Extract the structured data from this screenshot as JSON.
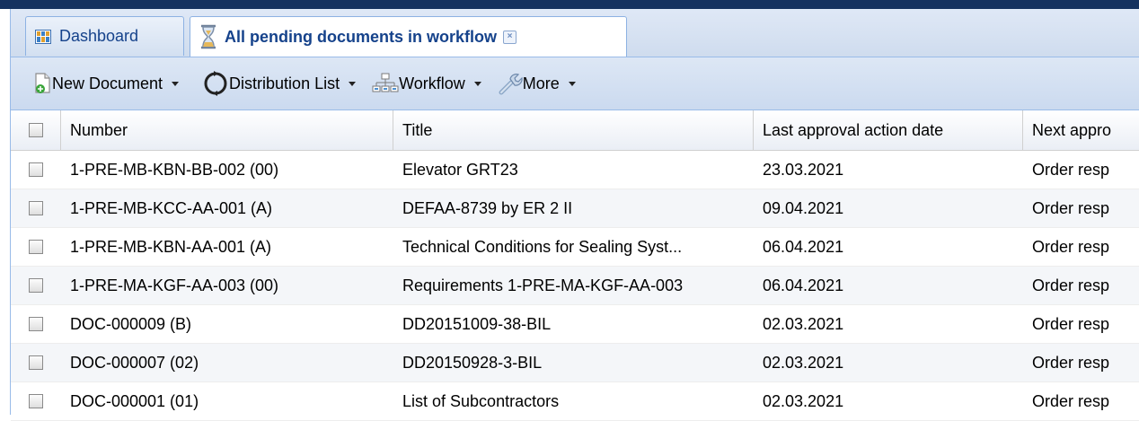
{
  "tabs": [
    {
      "label": "Dashboard",
      "icon": "dashboard-icon"
    },
    {
      "label": "All pending documents in workflow",
      "icon": "hourglass-icon",
      "close_icon": "close-icon"
    }
  ],
  "toolbar": {
    "new_document": "New Document",
    "distribution_list": "Distribution List",
    "workflow": "Workflow",
    "more": "More"
  },
  "grid": {
    "columns": [
      "Number",
      "Title",
      "Last approval action date",
      "Next appro"
    ],
    "rows": [
      {
        "number": "1-PRE-MB-KBN-BB-002 (00)",
        "title": "Elevator GRT23",
        "date": "23.03.2021",
        "next": "Order resp"
      },
      {
        "number": "1-PRE-MB-KCC-AA-001 (A)",
        "title": "DEFAA-8739 by ER 2 II",
        "date": "09.04.2021",
        "next": "Order resp"
      },
      {
        "number": "1-PRE-MB-KBN-AA-001 (A)",
        "title": "Technical Conditions for Sealing Syst...",
        "date": "06.04.2021",
        "next": "Order resp"
      },
      {
        "number": "1-PRE-MA-KGF-AA-003 (00)",
        "title": "Requirements 1-PRE-MA-KGF-AA-003",
        "date": "06.04.2021",
        "next": "Order resp"
      },
      {
        "number": "DOC-000009 (B)",
        "title": "DD20151009-38-BIL",
        "date": "02.03.2021",
        "next": "Order resp"
      },
      {
        "number": "DOC-000007 (02)",
        "title": "DD20150928-3-BIL",
        "date": "02.03.2021",
        "next": "Order resp"
      },
      {
        "number": "DOC-000001 (01)",
        "title": "List of Subcontractors",
        "date": "02.03.2021",
        "next": "Order resp"
      }
    ]
  },
  "colors": {
    "topbar": "#15325f",
    "tab_text": "#15428b",
    "border": "#99bbe8"
  }
}
